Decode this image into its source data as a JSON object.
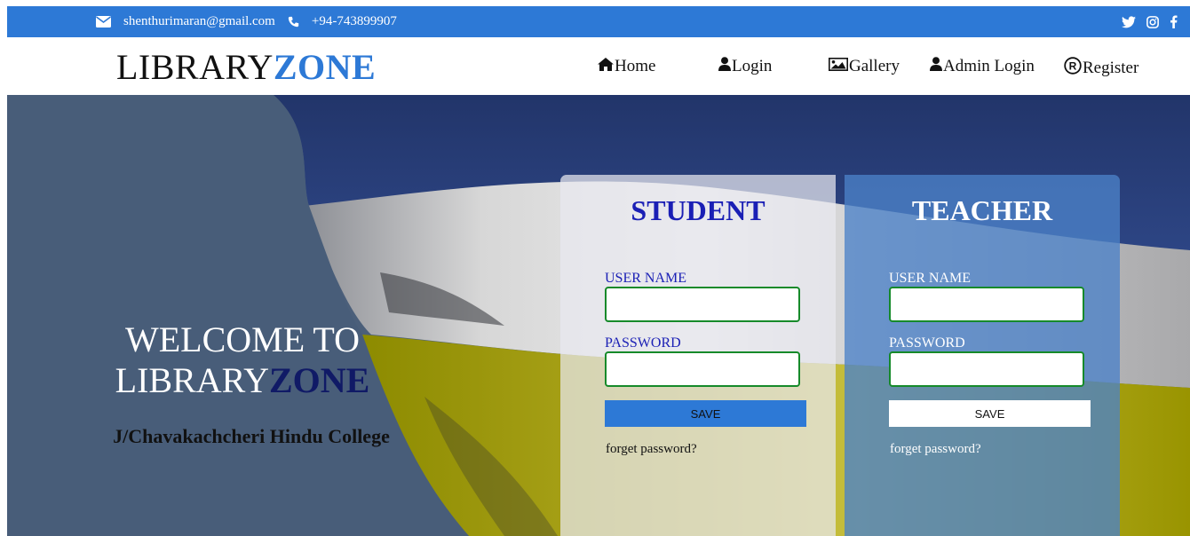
{
  "topbar": {
    "email": "shenthurimaran@gmail.com",
    "phone": "+94-743899907",
    "email_icon": "envelope-icon",
    "phone_icon": "phone-icon",
    "social_icons": [
      "twitter-icon",
      "instagram-icon",
      "facebook-icon"
    ],
    "color": "#2d79d6"
  },
  "brand": {
    "part1": "LIBRARY",
    "part2": "ZONE"
  },
  "nav": {
    "home": "Home",
    "login": "Login",
    "gallery": "Gallery",
    "admin_login": "Admin Login",
    "register": "Register",
    "icons": [
      "home-icon",
      "user-icon",
      "image-icon",
      "user-icon",
      "registered-icon"
    ]
  },
  "hero": {
    "welcome_line1": "WELCOME TO",
    "welcome_library": "LIBRARY",
    "welcome_zone": "ZONE",
    "college": "J/Chavakachcheri Hindu College"
  },
  "student": {
    "title": "STUDENT",
    "username_label": "USER NAME",
    "username_value": "",
    "password_label": "PASSWORD",
    "password_value": "",
    "save": "SAVE",
    "forget": "forget password?"
  },
  "teacher": {
    "title": "TEACHER",
    "username_label": "USER NAME",
    "username_value": "",
    "password_label": "PASSWORD",
    "password_value": "",
    "save": "SAVE",
    "forget": "forget password?"
  },
  "colors": {
    "accent": "#2d79d6",
    "dark_accent": "#101a66",
    "input_border": "#168a2a"
  }
}
